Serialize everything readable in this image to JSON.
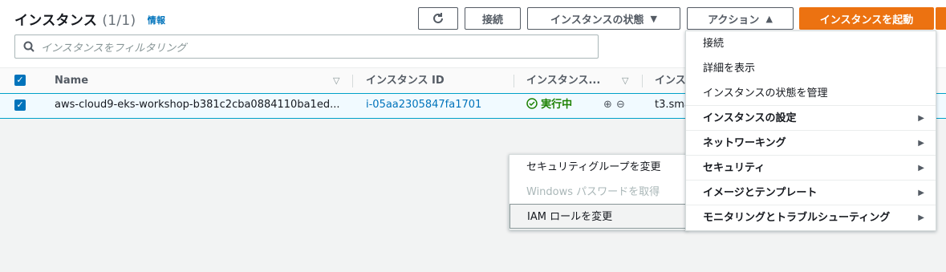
{
  "header": {
    "title": "インスタンス",
    "count": "(1/1)",
    "info": "情報"
  },
  "toolbar": {
    "connect": "接続",
    "state": "インスタンスの状態",
    "actions": "アクション",
    "launch": "インスタンスを起動"
  },
  "search": {
    "placeholder": "インスタンスをフィルタリング"
  },
  "table": {
    "columns": [
      "Name",
      "インスタンス ID",
      "インスタンス...",
      "インス"
    ],
    "row": {
      "name": "aws-cloud9-eks-workshop-b381c2cba0884110ba1ed...",
      "instance_id": "i-05aa2305847fa1701",
      "state": "実行中",
      "type": "t3.sma"
    }
  },
  "actions_menu": {
    "items": [
      "接続",
      "詳細を表示",
      "インスタンスの状態を管理"
    ],
    "groups": [
      "インスタンスの設定",
      "ネットワーキング",
      "セキュリティ",
      "イメージとテンプレート",
      "モニタリングとトラブルシューティング"
    ]
  },
  "security_submenu": {
    "items": [
      "セキュリティグループを変更",
      "Windows パスワードを取得",
      "IAM ロールを変更"
    ]
  },
  "colors": {
    "primary": "#ec7211",
    "link": "#0073bb",
    "running": "#1d8102"
  }
}
